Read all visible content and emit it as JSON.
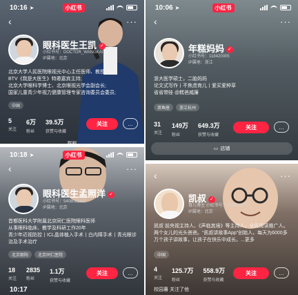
{
  "panels": [
    {
      "time": "10:16",
      "app_tag": "小红书",
      "name": "眼科医生王凯",
      "id_line": "小红书号：DOCTOR_WANGKAI",
      "ip_line": "IP属地：北京",
      "bio": [
        "北京大学人民医院眼视光中心主任医师、教授;",
        "BTV《我是大医生》特邀嘉宾主持;",
        "北京大学眼科学博士、北京眼视光学会副会长;",
        "国家儿童青少年视力健康管理专家咨询委员会委员;"
      ],
      "tags": [
        "中国"
      ],
      "stats": [
        {
          "num": "5",
          "label": "关注"
        },
        {
          "num": "6万",
          "label": "粉丝"
        },
        {
          "num": "39.5万",
          "label": "获赞与收藏"
        }
      ],
      "follow": "关注",
      "strip": "群聊"
    },
    {
      "time": "10:06",
      "app_tag": "小红书",
      "name": "年糕妈妈",
      "id_line": "小红书号：118420005",
      "ip_line": "IP属地：浙江",
      "bio": [
        "浙大医学硕士，二胎妈妈",
        "论文式写作丨不焦虑育儿丨爱买爱种草",
        "省省带娃 @糕爸威廉"
      ],
      "tags": [
        "双鱼座",
        "浙江杭州"
      ],
      "stats": [
        {
          "num": "31",
          "label": "关注"
        },
        {
          "num": "149万",
          "label": "粉丝"
        },
        {
          "num": "649.3万",
          "label": "获赞与收藏"
        }
      ],
      "follow": "关注",
      "shop": "店铺"
    },
    {
      "time": "10:18",
      "app_tag": "小红书",
      "name": "眼科医生孟照洋",
      "id_line": "小红书号：5408022657",
      "ip_line": "IP属地：北京",
      "bio": [
        "首都医科大学附属北京同仁医院眼科医师",
        "从事眼科临床、教学及科研工作20年",
        "青少年近视防控丨ICL晶体植入手术丨白内障手术丨青光眼诊治及手术治疗"
      ],
      "tags": [
        "北京朝阳",
        "北京同仁医院"
      ],
      "stats": [
        {
          "num": "18",
          "label": "关注"
        },
        {
          "num": "2835",
          "label": "粉丝"
        },
        {
          "num": "1.1万",
          "label": "获赞与收藏"
        }
      ],
      "follow": "关注",
      "bottom_time": "10:17"
    },
    {
      "name": "凯叔",
      "id_line": "小红书号：275013675",
      "ip_line": "IP属地：北京",
      "badge": "育儿博主",
      "bio": [
        "凯叔 前央视主持人、《声临其境》等主持人，全民阅读推广人。两个女儿的光头爸爸。“凯叔讲故事App”创始人，每天为6000多万个孩子讲故事，让孩子在快乐中成长。...更多"
      ],
      "tags": [
        "中国"
      ],
      "stats": [
        {
          "num": "4",
          "label": "关注"
        },
        {
          "num": "125.7万",
          "label": "粉丝"
        },
        {
          "num": "558.9万",
          "label": "获赞与收藏"
        }
      ],
      "follow": "关注",
      "strip": "校园薯 关注了他"
    }
  ],
  "ui": {
    "back_glyph": "‹",
    "more_glyph": "···",
    "verified_glyph": "✓",
    "chat_glyph": "…",
    "arrow_glyph": "➤",
    "accent": "#ff2442"
  }
}
